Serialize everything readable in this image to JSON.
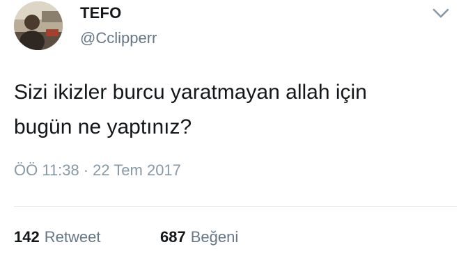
{
  "user": {
    "display_name": "TEFO",
    "handle": "@Cclipperr"
  },
  "tweet": {
    "lines": [
      "Sizi ikizler burcu yaratmayan allah için",
      "bugün ne yaptınız?"
    ],
    "time": "ÖÖ 11:38",
    "separator": "·",
    "date": "22 Tem 2017"
  },
  "stats": {
    "retweets_count": "142",
    "retweets_label": "Retweet",
    "likes_count": "687",
    "likes_label": "Beğeni"
  },
  "icons": {
    "menu": "chevron-down-icon"
  },
  "colors": {
    "text": "#14171a",
    "secondary": "#657786",
    "timestamp": "#8899a6",
    "divider": "#e1e8ed"
  }
}
